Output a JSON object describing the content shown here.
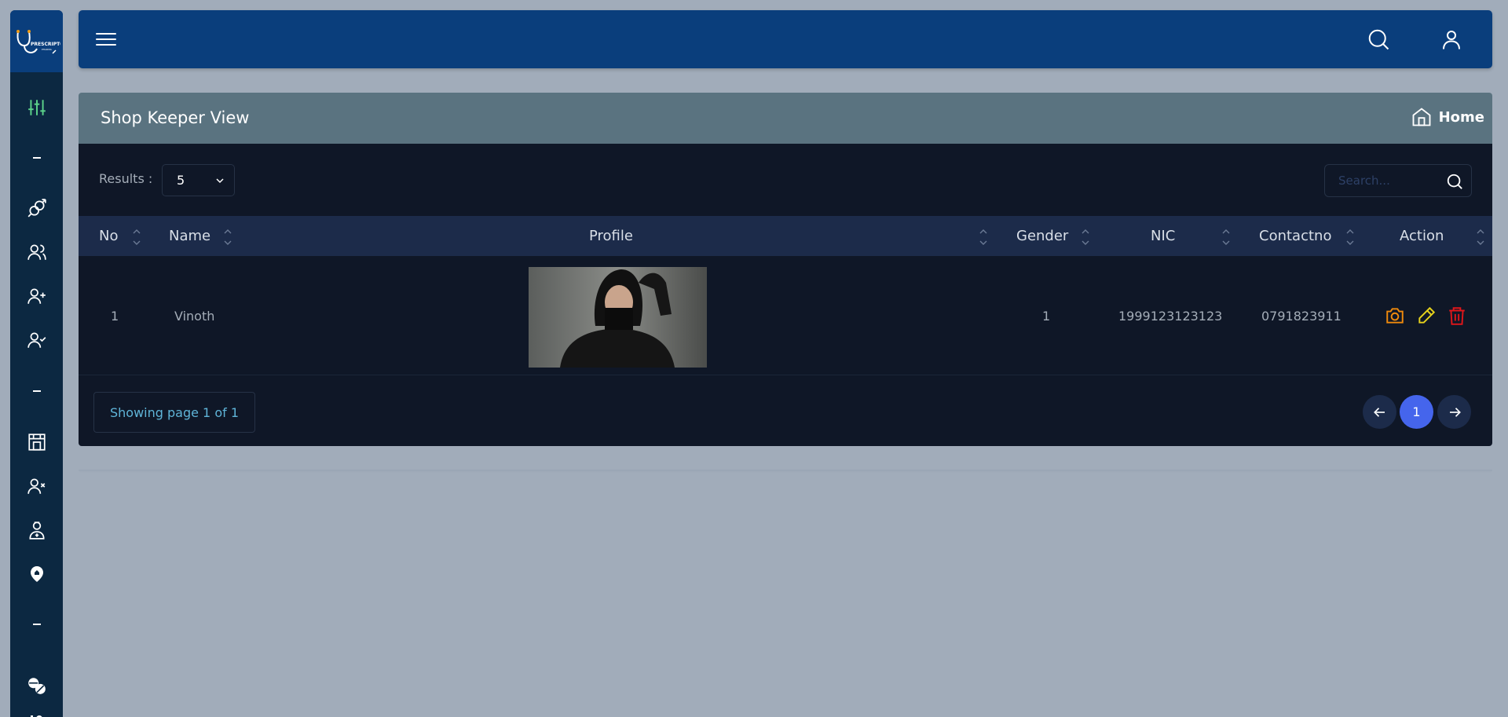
{
  "app": {
    "logo_text": "PRESCRIPTO"
  },
  "header": {
    "search_icon": "search-icon",
    "user_icon": "user-icon",
    "menu_icon": "hamburger-icon"
  },
  "page": {
    "title": "Shop Keeper View",
    "breadcrumb_home": "Home"
  },
  "toolbar": {
    "results_label": "Results :",
    "results_value": "5",
    "search_placeholder": "Search..."
  },
  "table": {
    "columns": [
      "No",
      "Name",
      "Profile",
      "Gender",
      "NIC",
      "Contactno",
      "Action"
    ],
    "rows": [
      {
        "no": "1",
        "name": "Vinoth",
        "gender": "1",
        "nic": "1999123123123",
        "contact": "0791823911"
      }
    ]
  },
  "pagination": {
    "summary": "Showing page 1 of 1",
    "current": "1"
  },
  "colors": {
    "header": "#0a3e7c",
    "sidebar": "#0c2841",
    "card": "#0f1727",
    "active_page": "#4565ec"
  }
}
